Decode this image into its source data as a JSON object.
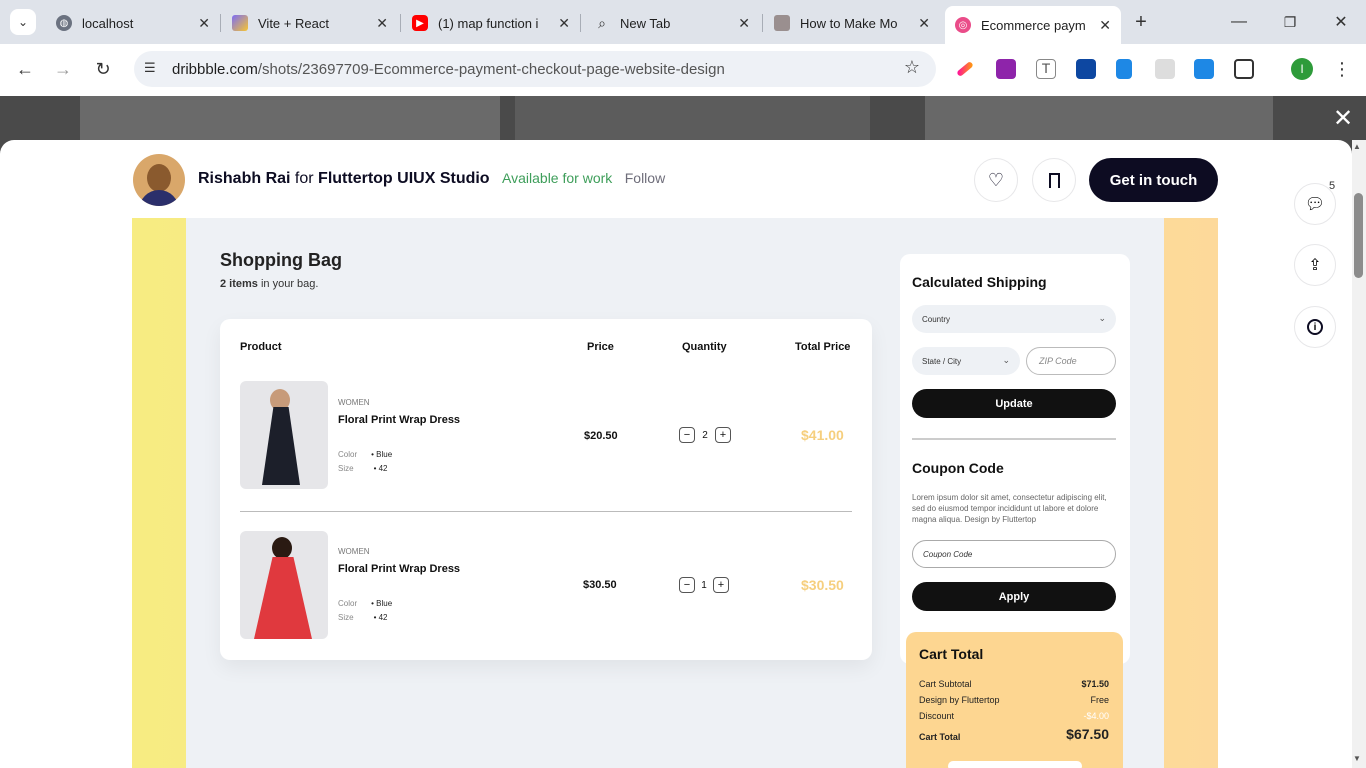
{
  "browser": {
    "tabs": [
      {
        "label": "localhost",
        "icon": "globe-icon"
      },
      {
        "label": "Vite + React",
        "icon": "vite-icon"
      },
      {
        "label": "(1) map function i",
        "icon": "youtube-icon"
      },
      {
        "label": "New Tab",
        "icon": "search-icon"
      },
      {
        "label": "How to Make Mo",
        "icon": "site-icon"
      },
      {
        "label": "Ecommerce paym",
        "icon": "dribbble-icon"
      }
    ],
    "url_domain": "dribbble.com",
    "url_path": "/shots/23697709-Ecommerce-payment-checkout-page-website-design",
    "profile_initial": "I"
  },
  "shot_header": {
    "author": "Rishabh Rai",
    "for_text": "for",
    "team": "Fluttertop UIUX Studio",
    "available": "Available for work",
    "follow": "Follow",
    "get_in_touch": "Get in touch",
    "comment_count": "5"
  },
  "bag": {
    "title": "Shopping Bag",
    "count_bold": "2 items",
    "count_rest": " in your bag.",
    "headers": {
      "product": "Product",
      "price": "Price",
      "quantity": "Quantity",
      "total": "Total Price"
    },
    "items": [
      {
        "category": "WOMEN",
        "name": "Floral Print Wrap Dress",
        "color_label": "Color",
        "color": "Blue",
        "size_label": "Size",
        "size": "42",
        "price": "$20.50",
        "qty": "2",
        "total": "$41.00"
      },
      {
        "category": "WOMEN",
        "name": "Floral Print Wrap Dress",
        "color_label": "Color",
        "color": "Blue",
        "size_label": "Size",
        "size": "42",
        "price": "$30.50",
        "qty": "1",
        "total": "$30.50"
      }
    ]
  },
  "shipping": {
    "title": "Calculated Shipping",
    "country": "Country",
    "state": "State / City",
    "zip_placeholder": "ZIP Code",
    "update": "Update"
  },
  "coupon": {
    "title": "Coupon Code",
    "desc": "Lorem ipsum dolor sit amet, consectetur adipiscing elit, sed do eiusmod tempor incididunt ut labore et dolore magna aliqua. Design by Fluttertop",
    "placeholder": "Coupon Code",
    "apply": "Apply"
  },
  "cart_total": {
    "title": "Cart Total",
    "rows": [
      {
        "label": "Cart Subtotal",
        "value": "$71.50"
      },
      {
        "label": "Design by Fluttertop",
        "value": "Free"
      },
      {
        "label": "Discount",
        "value": "-$4.00"
      }
    ],
    "total_label": "Cart Total",
    "total_value": "$67.50"
  },
  "colors": {
    "accent_dark": "#0d0c22",
    "available_green": "#3e9e5a",
    "price_gold": "#f6cf7e",
    "cart_bg": "#fdd691"
  }
}
